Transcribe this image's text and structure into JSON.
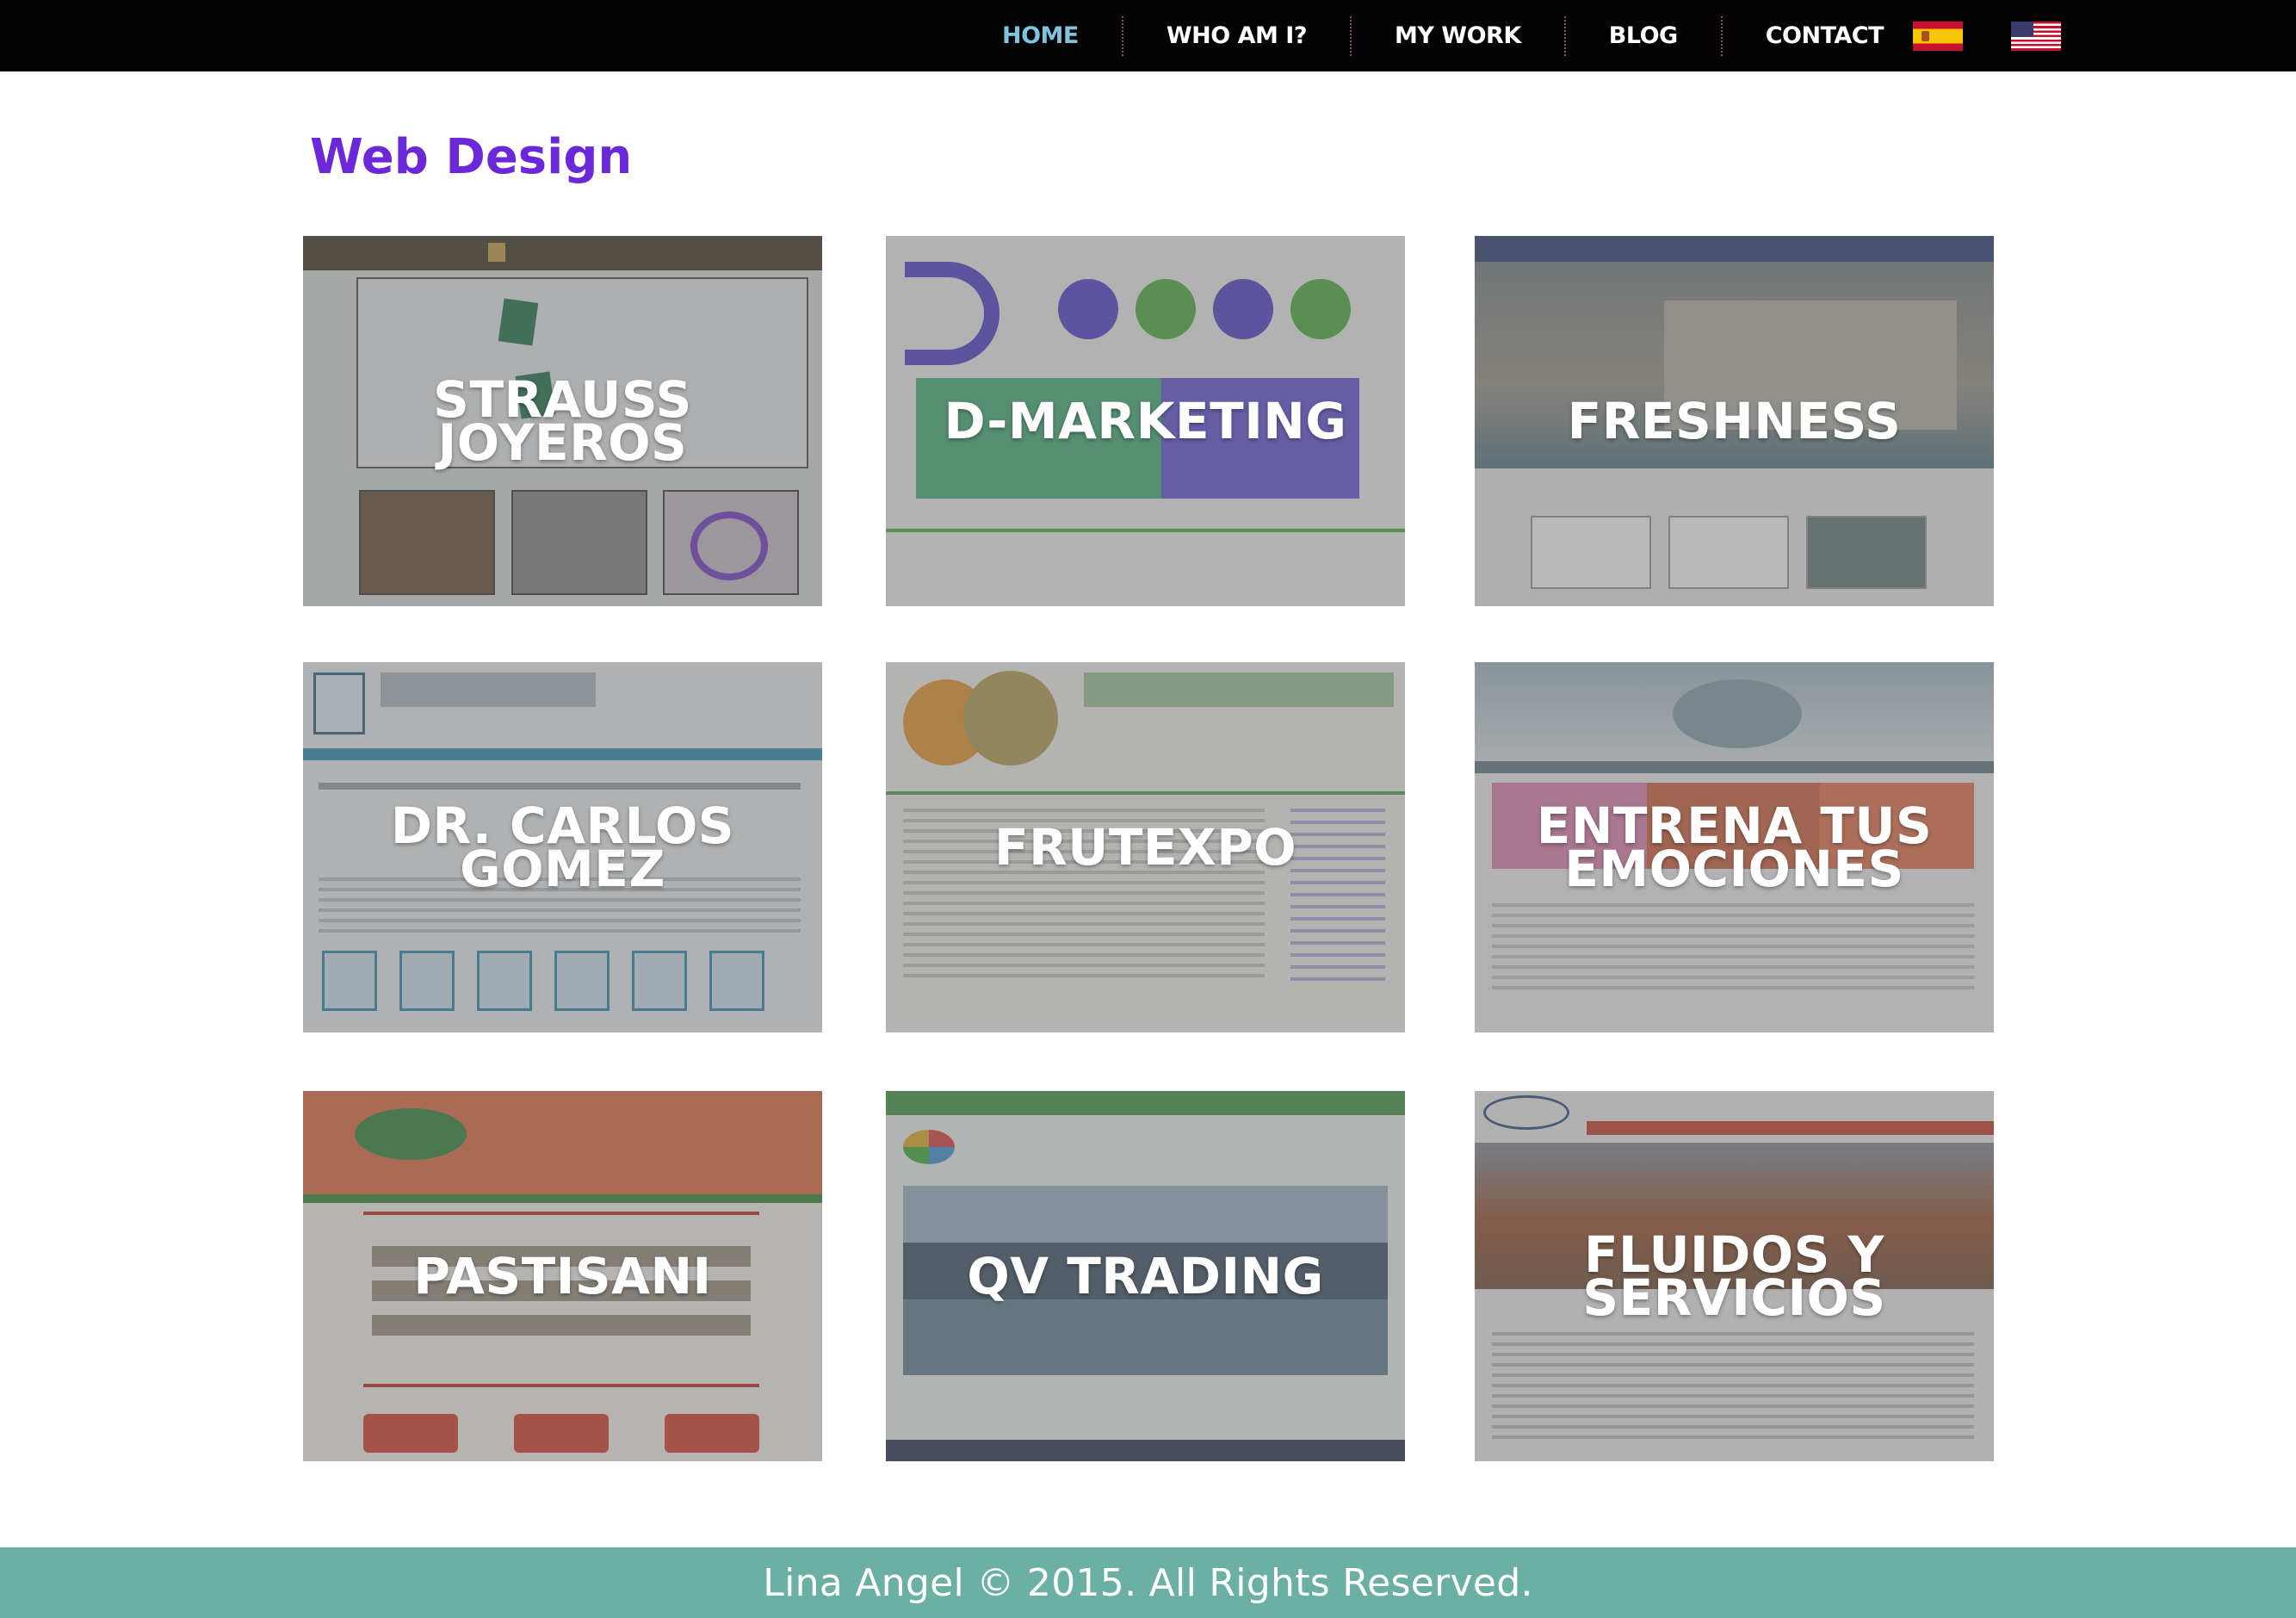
{
  "nav": {
    "items": [
      {
        "label": "HOME",
        "active": true
      },
      {
        "label": "WHO AM I?"
      },
      {
        "label": "MY WORK"
      },
      {
        "label": "BLOG"
      },
      {
        "label": "CONTACT"
      }
    ],
    "flags": [
      "spain-flag-icon",
      "usa-flag-icon"
    ],
    "active_color": "#7fc4dd"
  },
  "page": {
    "title": "Web Design",
    "title_color": "#6a28d8"
  },
  "portfolio": [
    {
      "label": "STRAUSS JOYEROS"
    },
    {
      "label": "D-MARKETING"
    },
    {
      "label": "FRESHNESS"
    },
    {
      "label": "DR. CARLOS GOMEZ"
    },
    {
      "label": "FRUTEXPO"
    },
    {
      "label": "ENTRENA TUS EMOCIONES"
    },
    {
      "label": "PASTISANI"
    },
    {
      "label": "QV TRADING"
    },
    {
      "label": "FLUIDOS Y SERVICIOS"
    }
  ],
  "footer": {
    "text": "Lina Angel © 2015. All Rights Reserved.",
    "background": "#6bb0a3"
  }
}
